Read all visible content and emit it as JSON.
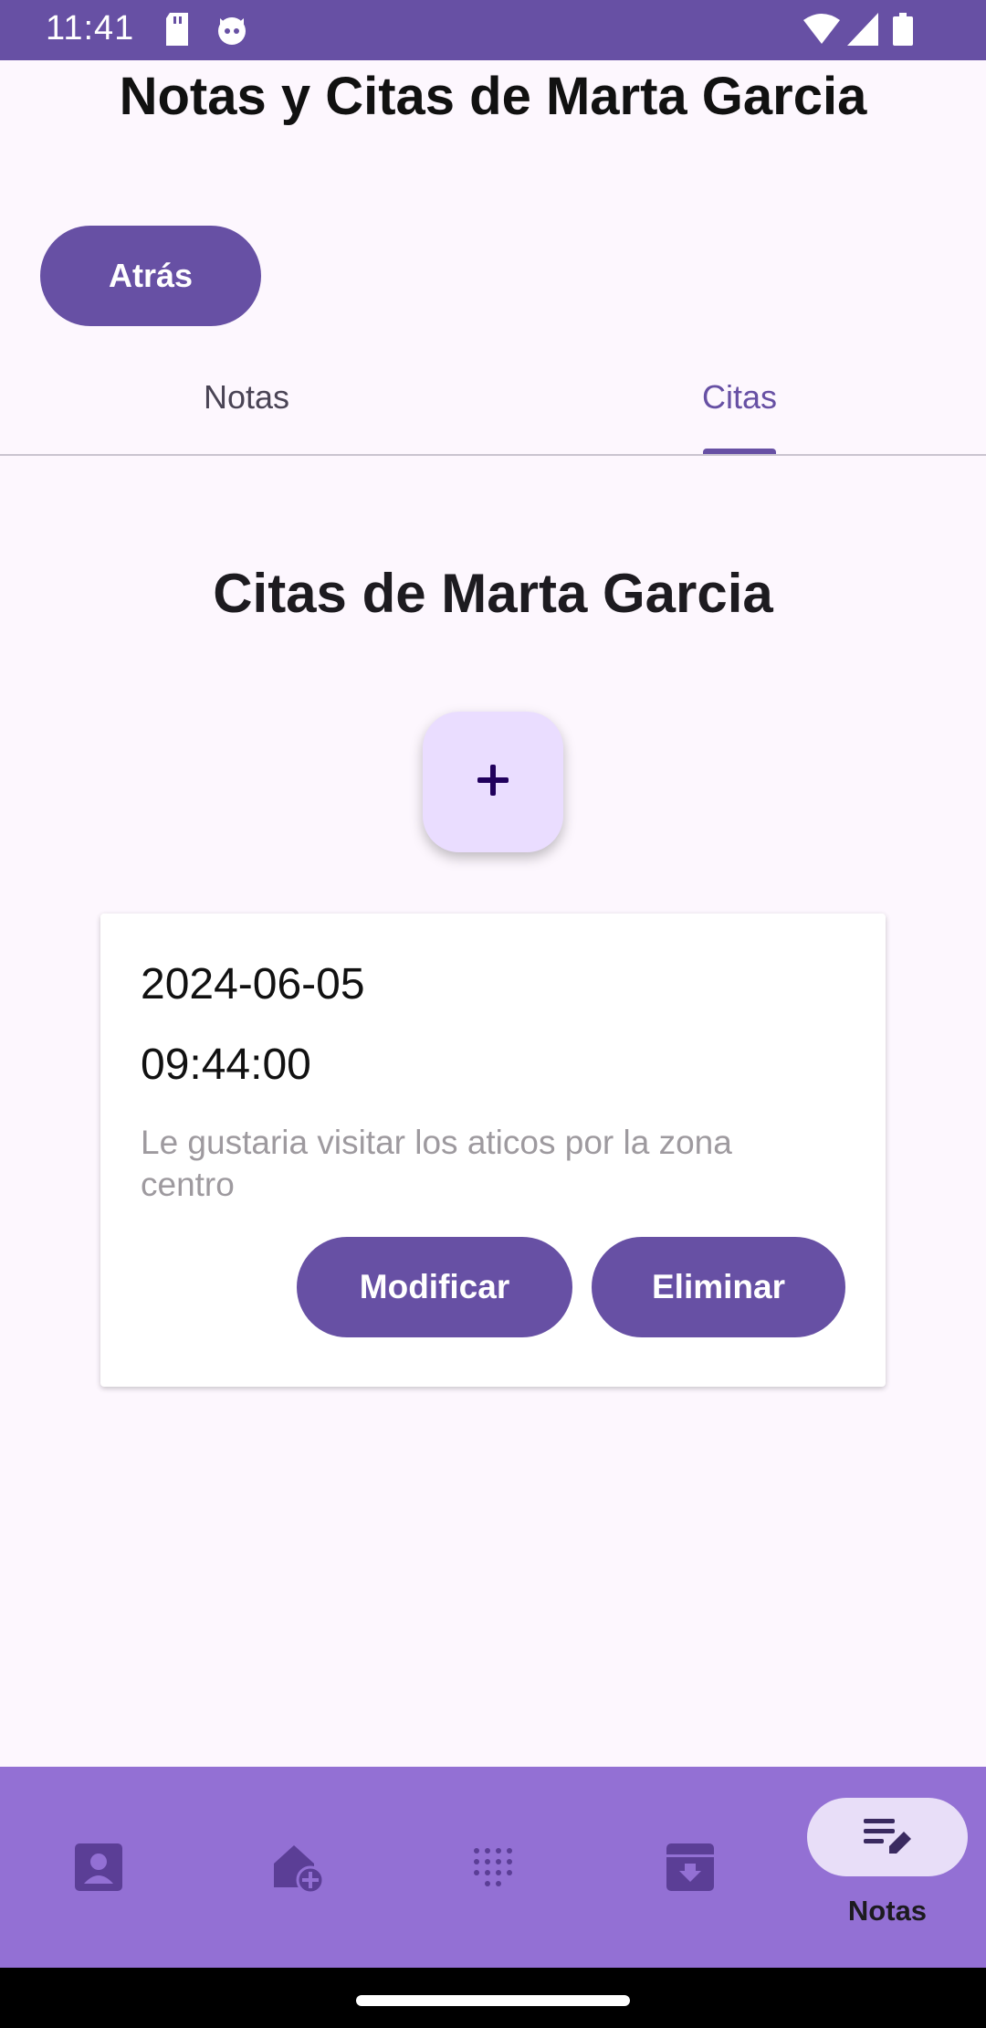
{
  "status_bar": {
    "time": "11:41",
    "icons": [
      "sd-card-icon",
      "cat-face-icon",
      "wifi-icon",
      "signal-icon",
      "battery-icon"
    ]
  },
  "header": {
    "title": "Notas y Citas de Marta Garcia",
    "back_label": "Atrás"
  },
  "tabs": [
    {
      "label": "Notas",
      "selected": false
    },
    {
      "label": "Citas",
      "selected": true
    }
  ],
  "section": {
    "title": "Citas de Marta Garcia",
    "add_icon": "plus-icon"
  },
  "appointments": [
    {
      "date": "2024-06-05",
      "time": "09:44:00",
      "description": "Le gustaria visitar los aticos por la zona centro",
      "modify_label": "Modificar",
      "delete_label": "Eliminar"
    }
  ],
  "bottom_nav": {
    "items": [
      {
        "icon": "contact-icon"
      },
      {
        "icon": "add-home-icon"
      },
      {
        "icon": "dialpad-icon"
      },
      {
        "icon": "archive-download-icon"
      },
      {
        "icon": "notes-edit-icon",
        "label": "Notas",
        "active": true
      }
    ]
  },
  "colors": {
    "primary": "#6750A4",
    "nav_background": "#9370D4",
    "fab_background": "#EADDFF",
    "page_background": "#FDF7FE"
  }
}
